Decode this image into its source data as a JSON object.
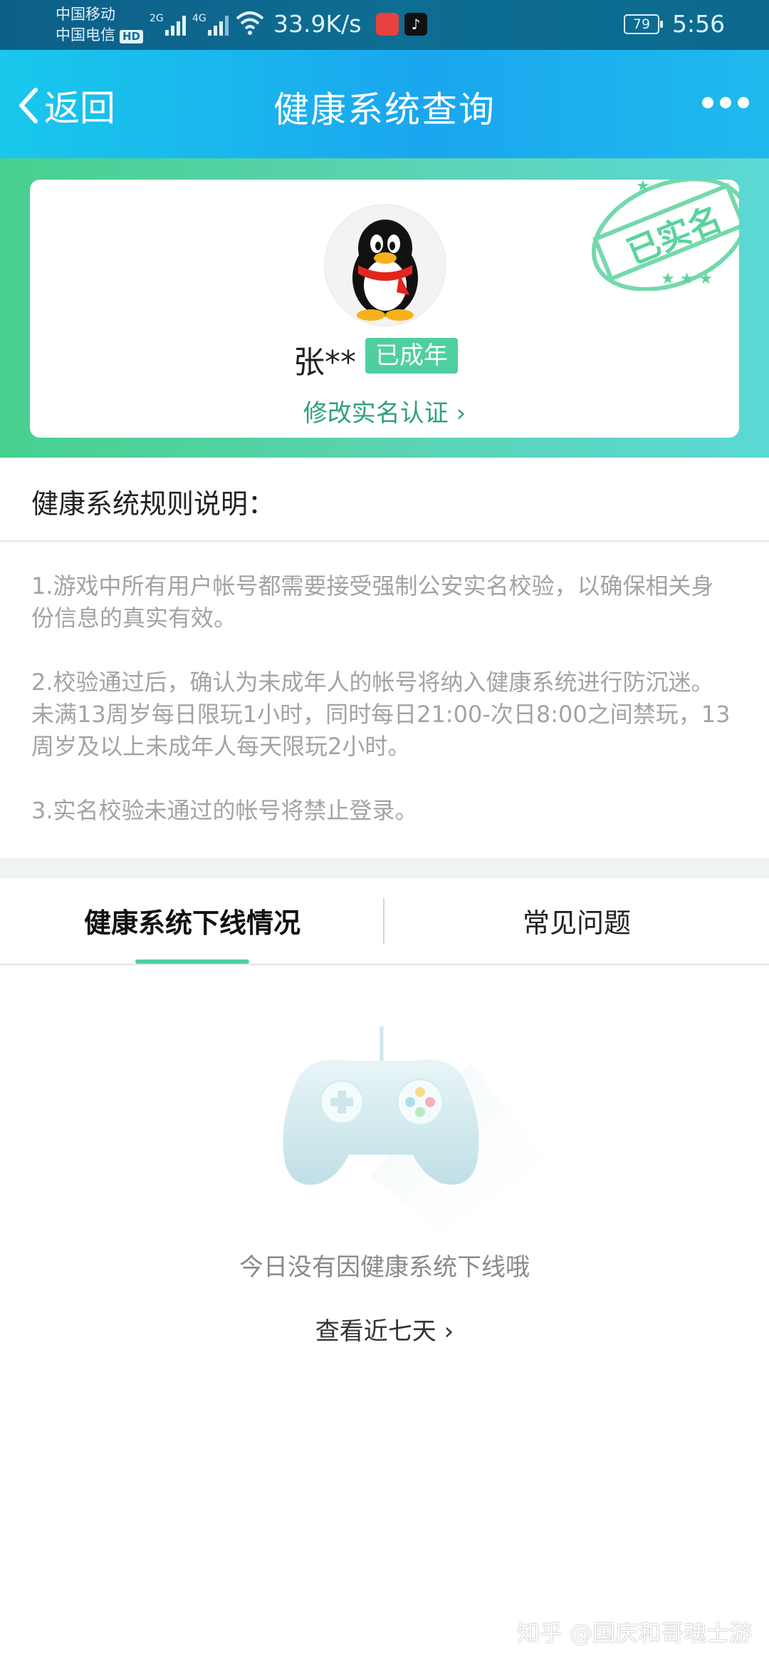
{
  "status_bar": {
    "carrier_1": "中国移动",
    "carrier_2": "中国电信",
    "hd_badge": "HD",
    "signal_1_label": "2G",
    "signal_2_label": "4G",
    "net_speed": "33.9K/s",
    "battery": "79",
    "time": "5:56"
  },
  "header": {
    "back_label": "返回",
    "title": "健康系统查询"
  },
  "profile": {
    "username": "张**",
    "adult_badge": "已成年",
    "modify_link": "修改实名认证 ›",
    "stamp_text": "已实名"
  },
  "rules": {
    "title": "健康系统规则说明：",
    "items": [
      "1.游戏中所有用户帐号都需要接受强制公安实名校验，以确保相关身份信息的真实有效。",
      "2.校验通过后，确认为未成年人的帐号将纳入健康系统进行防沉迷。未满13周岁每日限玩1小时，同时每日21:00-次日8:00之间禁玩，13周岁及以上未成年人每天限玩2小时。",
      "3.实名校验未通过的帐号将禁止登录。"
    ]
  },
  "tabs": [
    {
      "label": "健康系统下线情况",
      "active": true
    },
    {
      "label": "常见问题",
      "active": false
    }
  ],
  "empty_state": {
    "message": "今日没有因健康系统下线哦",
    "link": "查看近七天 ›"
  },
  "watermark": "知乎 @国庆和哥魂士游",
  "colors": {
    "header_accent": "#1aa6ee",
    "band_green": "#48d08f",
    "badge_green": "#4fcf9f",
    "link_green": "#2fa277",
    "tab_underline": "#4fcfa9"
  }
}
